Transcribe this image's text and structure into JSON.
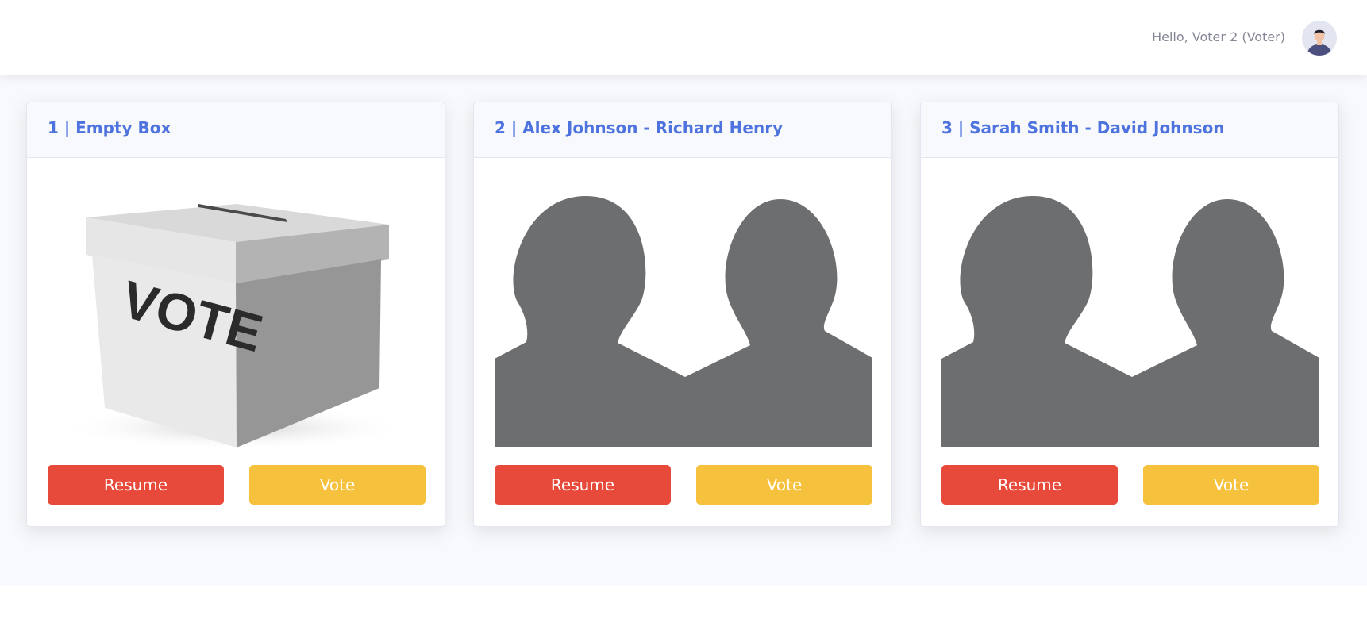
{
  "header": {
    "greeting": "Hello, Voter 2 (Voter)",
    "avatar_icon": "user-avatar-icon"
  },
  "colors": {
    "title": "#4e73df",
    "resume": "#e74a3b",
    "vote": "#f6c23e",
    "silhouette": "#6d6e70",
    "background": "#f8f9fc"
  },
  "cards": [
    {
      "title": "1 | Empty Box",
      "image": "ballot-box-image",
      "image_text": "VOTE",
      "resume_label": "Resume",
      "vote_label": "Vote"
    },
    {
      "title": "2 | Alex Johnson - Richard Henry",
      "image": "candidates-silhouette-image",
      "resume_label": "Resume",
      "vote_label": "Vote"
    },
    {
      "title": "3 | Sarah Smith - David Johnson",
      "image": "candidates-silhouette-image",
      "resume_label": "Resume",
      "vote_label": "Vote"
    }
  ]
}
